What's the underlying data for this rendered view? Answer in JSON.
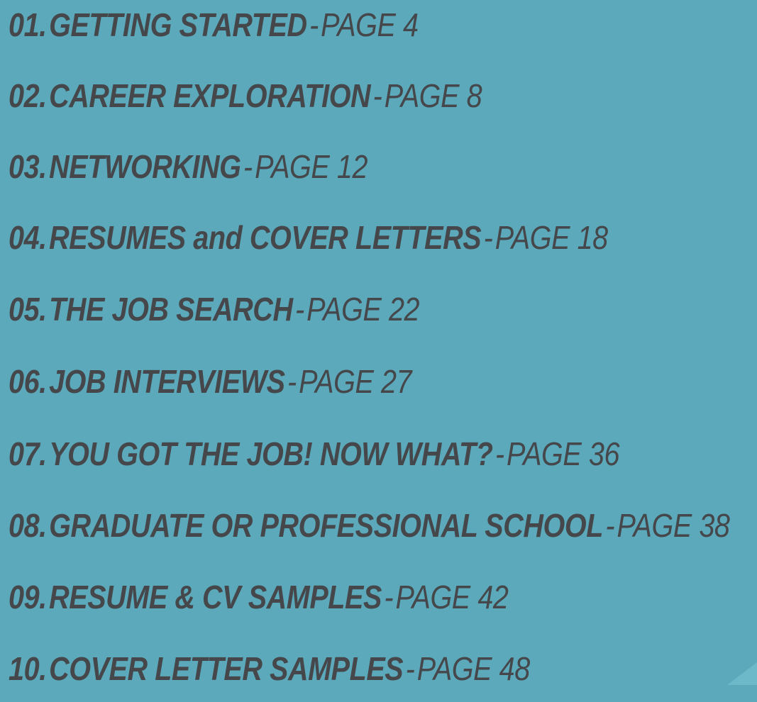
{
  "toc": {
    "items": [
      {
        "number": "01.",
        "title": "GETTING STARTED",
        "separator": "-",
        "page": "PAGE 4"
      },
      {
        "number": "02.",
        "title": "CAREER EXPLORATION",
        "separator": "-",
        "page": "PAGE 8"
      },
      {
        "number": "03.",
        "title": "NETWORKING",
        "separator": "-",
        "page": "PAGE 12"
      },
      {
        "number": "04.",
        "title": "RESUMES and COVER LETTERS",
        "separator": "-",
        "page": "PAGE 18"
      },
      {
        "number": "05.",
        "title": "THE JOB SEARCH",
        "separator": "-",
        "page": "PAGE 22"
      },
      {
        "number": "06.",
        "title": "JOB INTERVIEWS",
        "separator": "-",
        "page": "PAGE 27"
      },
      {
        "number": "07.",
        "title": "YOU GOT THE JOB! NOW WHAT?",
        "separator": "-",
        "page": "PAGE 36"
      },
      {
        "number": "08.",
        "title": "GRADUATE OR PROFESSIONAL SCHOOL",
        "separator": "-",
        "page": "PAGE 38"
      },
      {
        "number": "09.",
        "title": "RESUME & CV SAMPLES",
        "separator": "-",
        "page": "PAGE 42"
      },
      {
        "number": "10.",
        "title": "COVER LETTER SAMPLES",
        "separator": "-",
        "page": "PAGE 48"
      }
    ]
  },
  "colors": {
    "background": "#5ba9ba",
    "text": "#45474a",
    "corner_accent": "#6db9c9"
  }
}
